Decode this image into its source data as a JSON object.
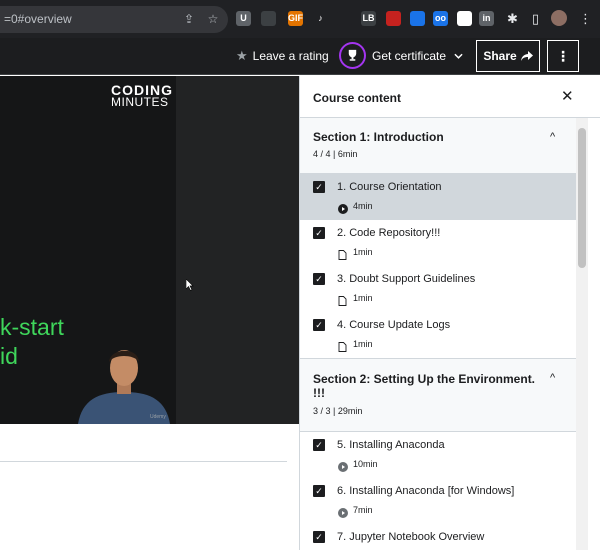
{
  "browser": {
    "url": "=0#overview",
    "extensions": [
      {
        "name": "u-ext",
        "label": "U",
        "color": "#5f6368"
      },
      {
        "name": "translate-ext",
        "label": "",
        "color": "#3c4043"
      },
      {
        "name": "gif-ext",
        "label": "GIF",
        "color": "#e37400"
      },
      {
        "name": "music-ext",
        "label": "♪",
        "color": "#202124"
      },
      {
        "name": "pen-ext",
        "label": "",
        "color": "#202124"
      },
      {
        "name": "lb-ext",
        "label": "LB",
        "color": "#3c4043"
      },
      {
        "name": "red-ext",
        "label": "",
        "color": "#c5221f"
      },
      {
        "name": "react-ext",
        "label": "",
        "color": "#1a73e8"
      },
      {
        "name": "oo-ext",
        "label": "oo",
        "color": "#1a73e8"
      },
      {
        "name": "qr-ext",
        "label": "",
        "color": "#ffffff"
      },
      {
        "name": "li-ext",
        "label": "in",
        "color": "#5f6368"
      },
      {
        "name": "rec-ext",
        "label": "",
        "color": "#c5221f"
      }
    ]
  },
  "topbar": {
    "rating_label": "Leave a rating",
    "certificate_label": "Get certificate",
    "share_label": "Share"
  },
  "video": {
    "brand_line1": "CODING",
    "brand_line2": "MINUTES",
    "overlay_line1": "k-start",
    "overlay_line2": "id",
    "watermark": "Udemy"
  },
  "sidebar": {
    "title": "Course content",
    "sections": [
      {
        "title": "Section 1: Introduction",
        "meta": "4 / 4 | 6min",
        "lectures": [
          {
            "title": "1. Course Orientation",
            "duration": "4min",
            "type": "video",
            "active": true
          },
          {
            "title": "2. Code Repository!!!",
            "duration": "1min",
            "type": "article",
            "active": false
          },
          {
            "title": "3. Doubt Support Guidelines",
            "duration": "1min",
            "type": "article",
            "active": false
          },
          {
            "title": "4. Course Update Logs",
            "duration": "1min",
            "type": "article",
            "active": false
          }
        ]
      },
      {
        "title_line1": "Section 2: Setting Up the Environment.",
        "title_line2": "!!!",
        "meta": "3 / 3 | 29min",
        "lectures": [
          {
            "title": "5. Installing Anaconda",
            "duration": "10min",
            "type": "video",
            "active": false
          },
          {
            "title": "6. Installing Anaconda [for Windows]",
            "duration": "7min",
            "type": "video",
            "active": false
          },
          {
            "title": "7. Jupyter Notebook Overview",
            "duration": "",
            "type": "video",
            "active": false
          }
        ]
      }
    ]
  },
  "colors": {
    "accent_purple": "#a435f0",
    "overlay_green": "#3fd65b",
    "active_row": "#d1d7dc"
  }
}
